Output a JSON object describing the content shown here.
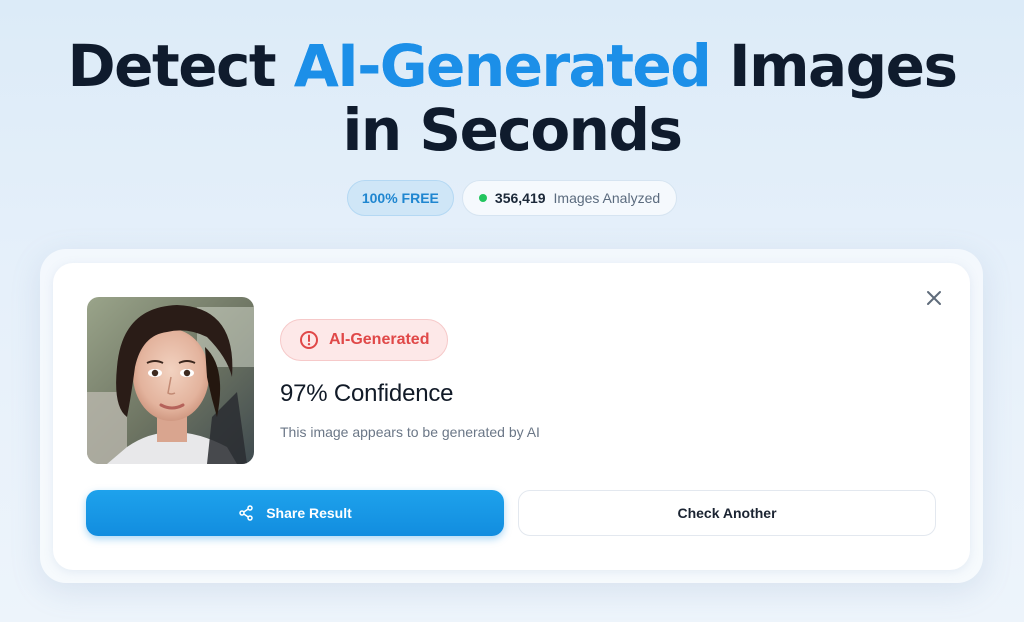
{
  "hero": {
    "headline_part1": "Detect",
    "headline_accent": "AI-Generated",
    "headline_part2": "Images",
    "headline_line2": "in Seconds",
    "accent_color": "#1c8fe8"
  },
  "badges": {
    "free_label": "100% FREE",
    "analyzed_count": "356,419",
    "analyzed_label": "Images Analyzed",
    "status_dot_color": "#22c55e"
  },
  "result": {
    "image_alt": "Uploaded photo of a woman",
    "status_label": "AI-Generated",
    "status_icon": "alert-circle-icon",
    "status_color": "#e04848",
    "confidence_text": "97% Confidence",
    "description": "This image appears to be generated by AI",
    "close_icon": "close-icon"
  },
  "actions": {
    "share_label": "Share Result",
    "share_icon": "share-icon",
    "check_label": "Check Another",
    "primary_color": "#1897e6"
  }
}
